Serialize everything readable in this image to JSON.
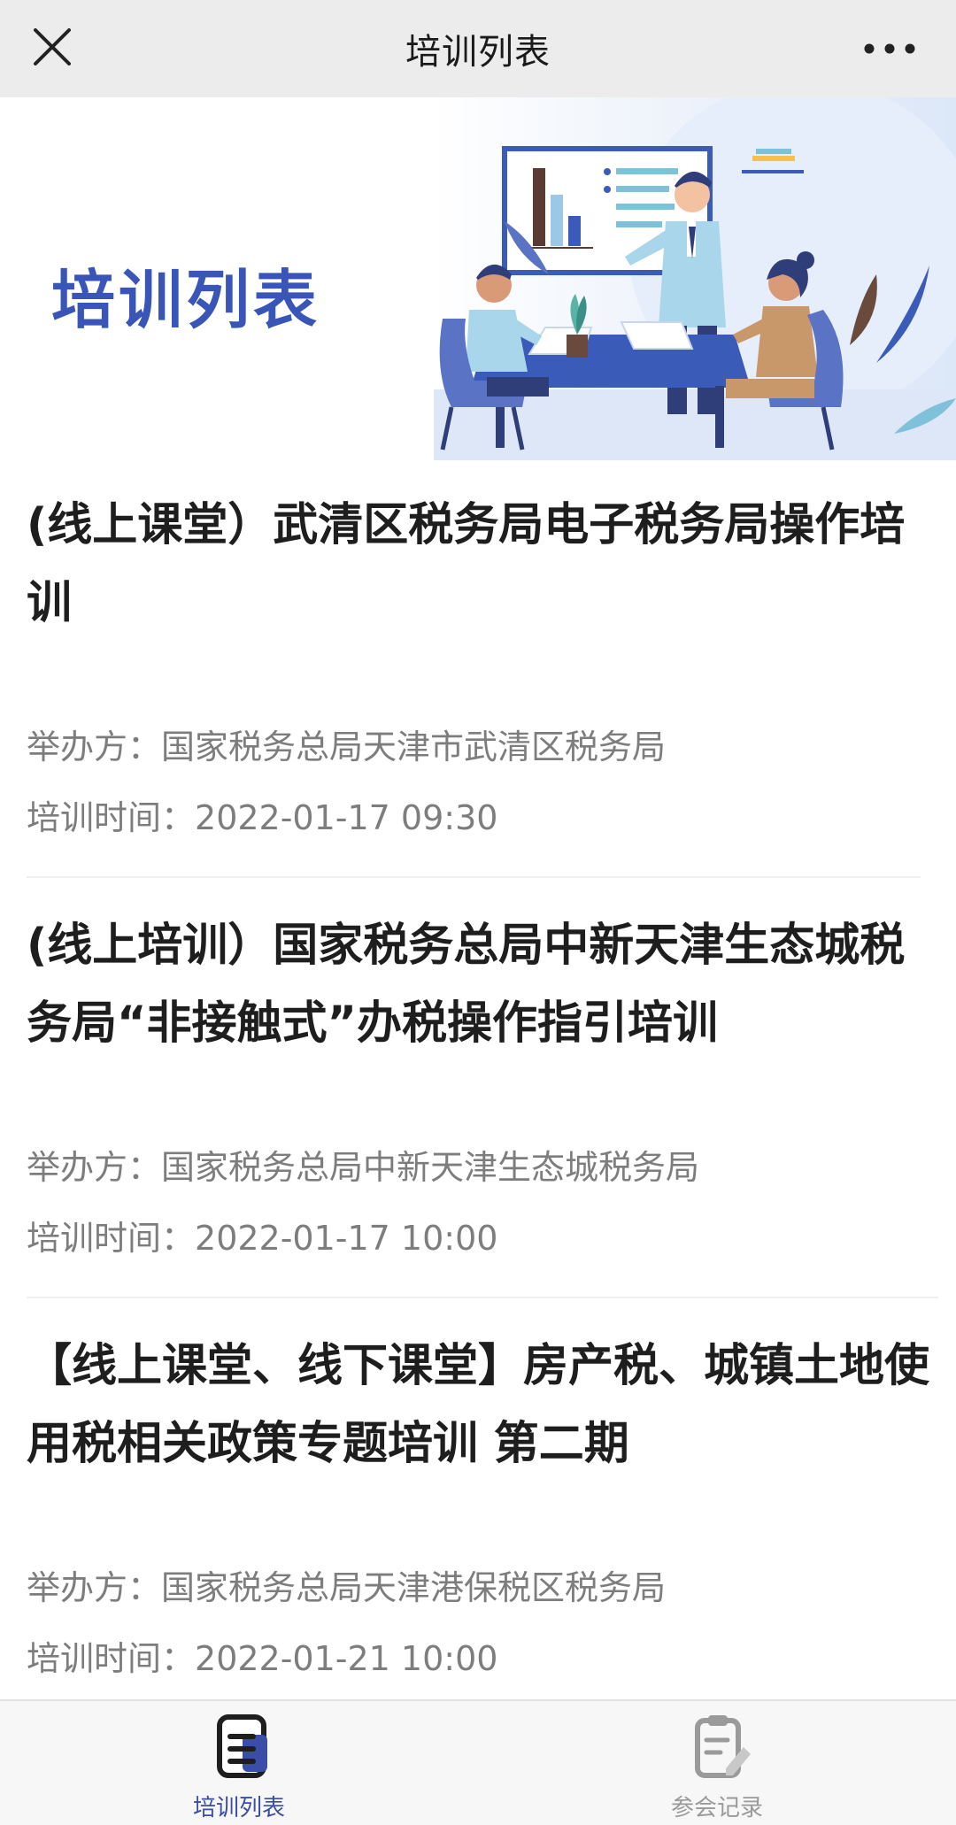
{
  "header": {
    "title": "培训列表",
    "close_icon": "close-icon",
    "more_icon": "more-horizontal-icon"
  },
  "banner": {
    "title": "培训列表",
    "illustration": "meeting-presentation-illustration"
  },
  "trainings": [
    {
      "title": "(线上课堂）武清区税务局电子税务局操作培训",
      "organizer_label": "举办方：",
      "organizer": "国家税务总局天津市武清区税务局",
      "time_label": "培训时间：",
      "time": "2022-01-17 09:30"
    },
    {
      "title": "(线上培训）国家税务总局中新天津生态城税务局“非接触式”办税操作指引培训",
      "organizer_label": "举办方：",
      "organizer": "国家税务总局中新天津生态城税务局",
      "time_label": "培训时间：",
      "time": "2022-01-17 10:00"
    },
    {
      "title": "【线上课堂、线下课堂】房产税、城镇土地使用税相关政策专题培训 第二期",
      "organizer_label": "举办方：",
      "organizer": "国家税务总局天津港保税区税务局",
      "time_label": "培训时间：",
      "time": "2022-01-21 10:00"
    }
  ],
  "tabbar": {
    "tabs": [
      {
        "label": "培训列表",
        "icon": "training-list-icon",
        "active": true
      },
      {
        "label": "参会记录",
        "icon": "attendance-record-icon",
        "active": false
      }
    ]
  },
  "colors": {
    "accent": "#3a4ea8",
    "banner_title": "#3a55b8",
    "muted_text": "#7d7d7d"
  }
}
